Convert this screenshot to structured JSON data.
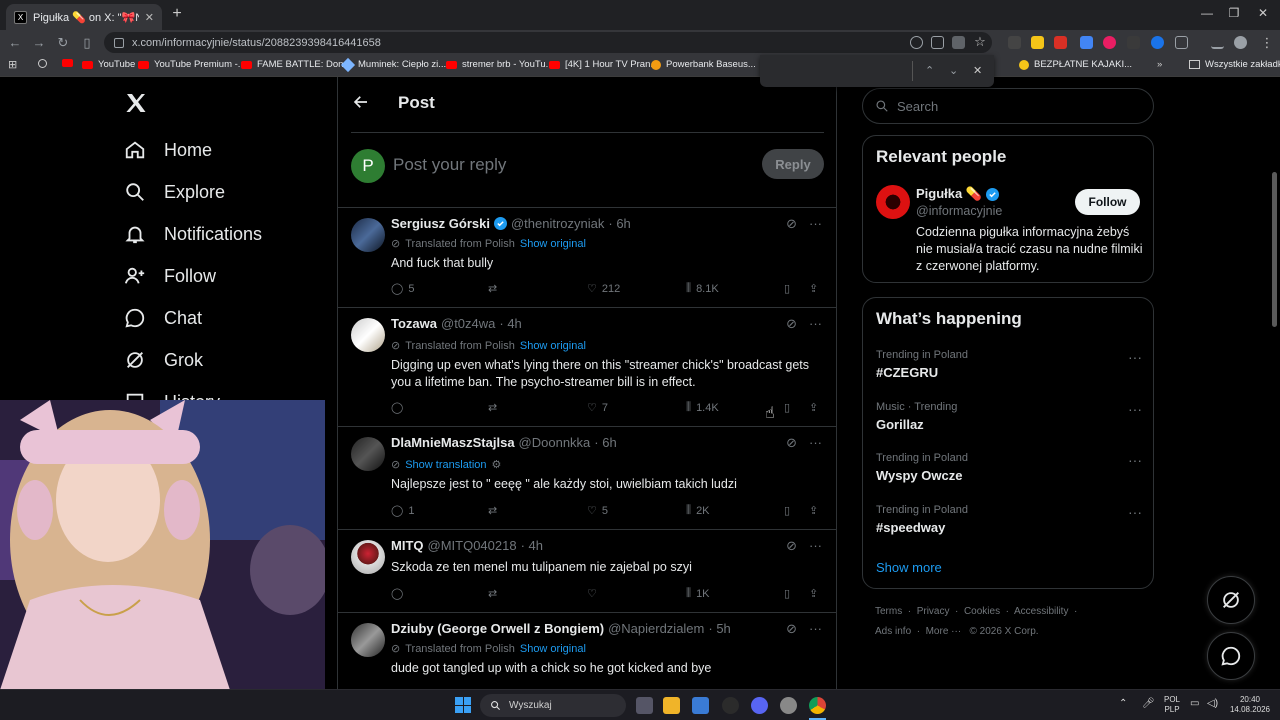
{
  "browser": {
    "tab_title": "Pigułka 💊 on X: \"🎀Na strimie",
    "tab_close": "✕",
    "new_tab": "+",
    "url": "x.com/informacyjnie/status/2088239398416441658",
    "bookmarks": [
      "YouTube",
      "YouTube Premium -...",
      "FAME BATTLE: Don...",
      "Muminek: Ciepło zi...",
      "stremer brb - YouTu...",
      "[4K] 1 Hour TV Pran...",
      "Powerbank Baseus...",
      "BEZPŁATNE KAJAKI...",
      "Wszystkie zakładki"
    ],
    "find_bar": {
      "up": "⌃",
      "down": "⌄",
      "close": "✕"
    }
  },
  "nav": {
    "items": [
      {
        "label": "Home",
        "icon": "home-icon"
      },
      {
        "label": "Explore",
        "icon": "search-icon"
      },
      {
        "label": "Notifications",
        "icon": "bell-icon"
      },
      {
        "label": "Follow",
        "icon": "follow-icon"
      },
      {
        "label": "Chat",
        "icon": "chat-icon"
      },
      {
        "label": "Grok",
        "icon": "grok-icon"
      },
      {
        "label": "History",
        "icon": "history-icon"
      }
    ]
  },
  "header": {
    "title": "Post"
  },
  "reply": {
    "avatar_letter": "P",
    "placeholder": "Post your reply",
    "button": "Reply"
  },
  "posts": [
    {
      "name": "Sergiusz Górski",
      "verified": true,
      "handle": "@thenitrozyniak",
      "time": "· 6h",
      "translated": "Translated from Polish",
      "show": "Show original",
      "text": "And fuck that bully",
      "replies": "5",
      "retweets": "",
      "likes": "212",
      "views": "8.1K"
    },
    {
      "name": "Tozawa",
      "verified": false,
      "handle": "@t0z4wa",
      "time": "· 4h",
      "translated": "Translated from Polish",
      "show": "Show original",
      "text": "Digging up even what's lying there on this \"streamer chick's\" broadcast gets you a lifetime ban. The psycho-streamer bill is in effect.",
      "replies": "",
      "retweets": "",
      "likes": "7",
      "views": "1.4K"
    },
    {
      "name": "DlaMnieMaszStajlsa",
      "verified": false,
      "handle": "@Doonnkka",
      "time": "· 6h",
      "translated": "",
      "show": "Show translation",
      "text": "Najlepsze jest to \" eeęę \" ale każdy stoi, uwielbiam takich ludzi",
      "replies": "1",
      "retweets": "",
      "likes": "5",
      "views": "2K"
    },
    {
      "name": "MITQ",
      "verified": false,
      "handle": "@MITQ040218",
      "time": "· 4h",
      "translated": "",
      "show": "",
      "text": "Szkoda ze ten menel mu tulipanem nie zajebal po szyi",
      "replies": "",
      "retweets": "",
      "likes": "",
      "views": "1K"
    },
    {
      "name": "Dziuby (George Orwell z Bongiem)",
      "verified": false,
      "handle": "@Napierdzialem",
      "time": "· 5h",
      "translated": "Translated from Polish",
      "show": "Show original",
      "text": "dude got tangled up with a chick so he got kicked and bye",
      "replies": "",
      "retweets": "",
      "likes": "",
      "views": ""
    }
  ],
  "right": {
    "search_placeholder": "Search",
    "relevant": {
      "title": "Relevant people",
      "name": "Pigułka 💊",
      "handle": "@informacyjnie",
      "follow": "Follow",
      "bio": "Codzienna pigułka informacyjna żebyś nie musiał/a tracić czasu na nudne filmiki z czerwonej platformy."
    },
    "happening": {
      "title": "What’s happening",
      "trends": [
        {
          "category": "Trending in Poland",
          "name": "#CZEGRU"
        },
        {
          "category": "Music · Trending",
          "name": "Gorillaz"
        },
        {
          "category": "Trending in Poland",
          "name": "Wyspy Owcze"
        },
        {
          "category": "Trending in Poland",
          "name": "#speedway"
        }
      ],
      "show_more": "Show more"
    },
    "footer": {
      "line1": [
        "Terms",
        "Privacy",
        "Cookies",
        "Accessibility"
      ],
      "line2": [
        "Ads info",
        "More ···",
        "© 2026 X Corp."
      ]
    }
  },
  "taskbar": {
    "search": "Wyszukaj",
    "lang": "POL",
    "lang2": "PLP",
    "time": "20:40",
    "date": "14.08.2026"
  },
  "colors": {
    "accent": "#1d9bf0",
    "bg": "#000000",
    "border": "#2f3336",
    "muted": "#71767b"
  }
}
